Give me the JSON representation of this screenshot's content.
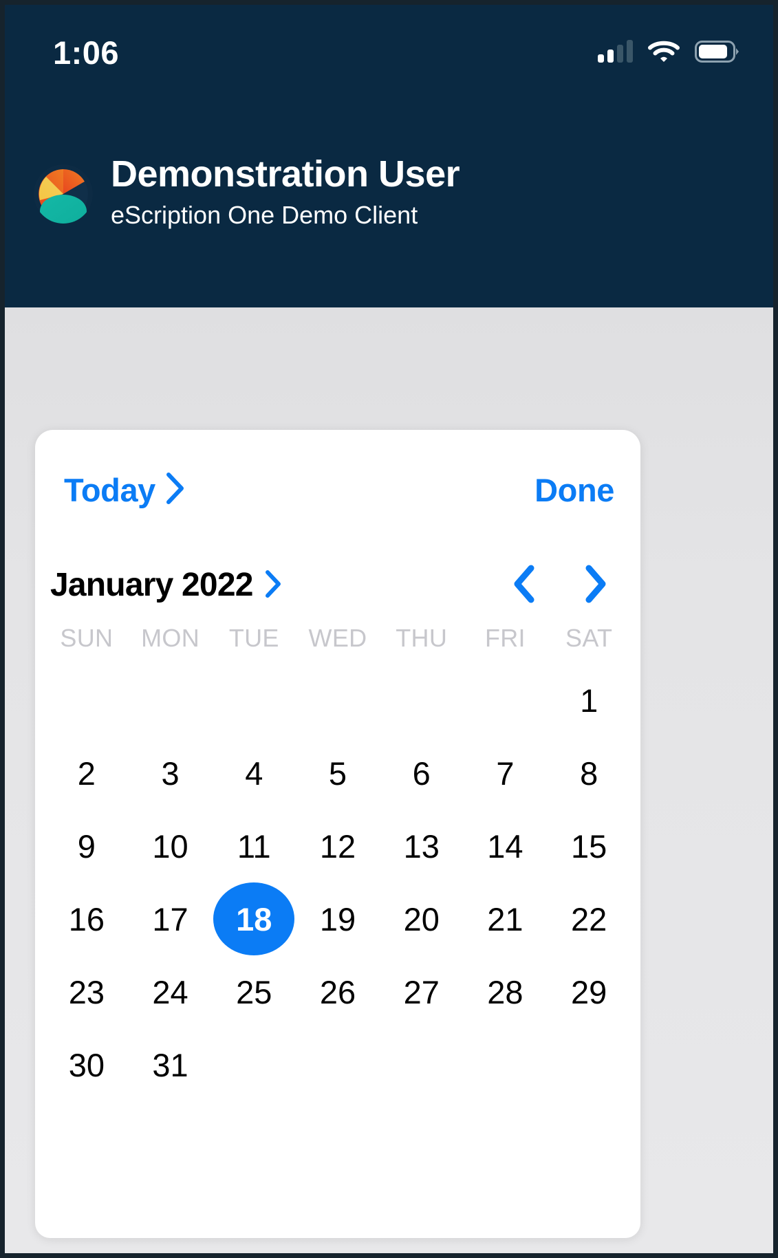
{
  "status_bar": {
    "time": "1:06",
    "signal_icon": "cellular-signal-icon",
    "wifi_icon": "wifi-icon",
    "battery_icon": "battery-icon"
  },
  "header": {
    "logo_icon": "escription-pie-logo-icon",
    "user_name": "Demonstration User",
    "client_name": "eScription One Demo Client",
    "background_color": "#0a2942"
  },
  "date_picker": {
    "today_label": "Today",
    "today_chevron_icon": "chevron-right-icon",
    "done_label": "Done",
    "month_label": "January 2022",
    "month_chevron_icon": "chevron-right-icon",
    "prev_month_icon": "chevron-left-icon",
    "next_month_icon": "chevron-right-icon",
    "accent_color": "#0b7cf5",
    "weekdays": [
      "SUN",
      "MON",
      "TUE",
      "WED",
      "THU",
      "FRI",
      "SAT"
    ],
    "leading_blanks": 6,
    "days": [
      "1",
      "2",
      "3",
      "4",
      "5",
      "6",
      "7",
      "8",
      "9",
      "10",
      "11",
      "12",
      "13",
      "14",
      "15",
      "16",
      "17",
      "18",
      "19",
      "20",
      "21",
      "22",
      "23",
      "24",
      "25",
      "26",
      "27",
      "28",
      "29",
      "30",
      "31"
    ],
    "selected_day": "18"
  }
}
